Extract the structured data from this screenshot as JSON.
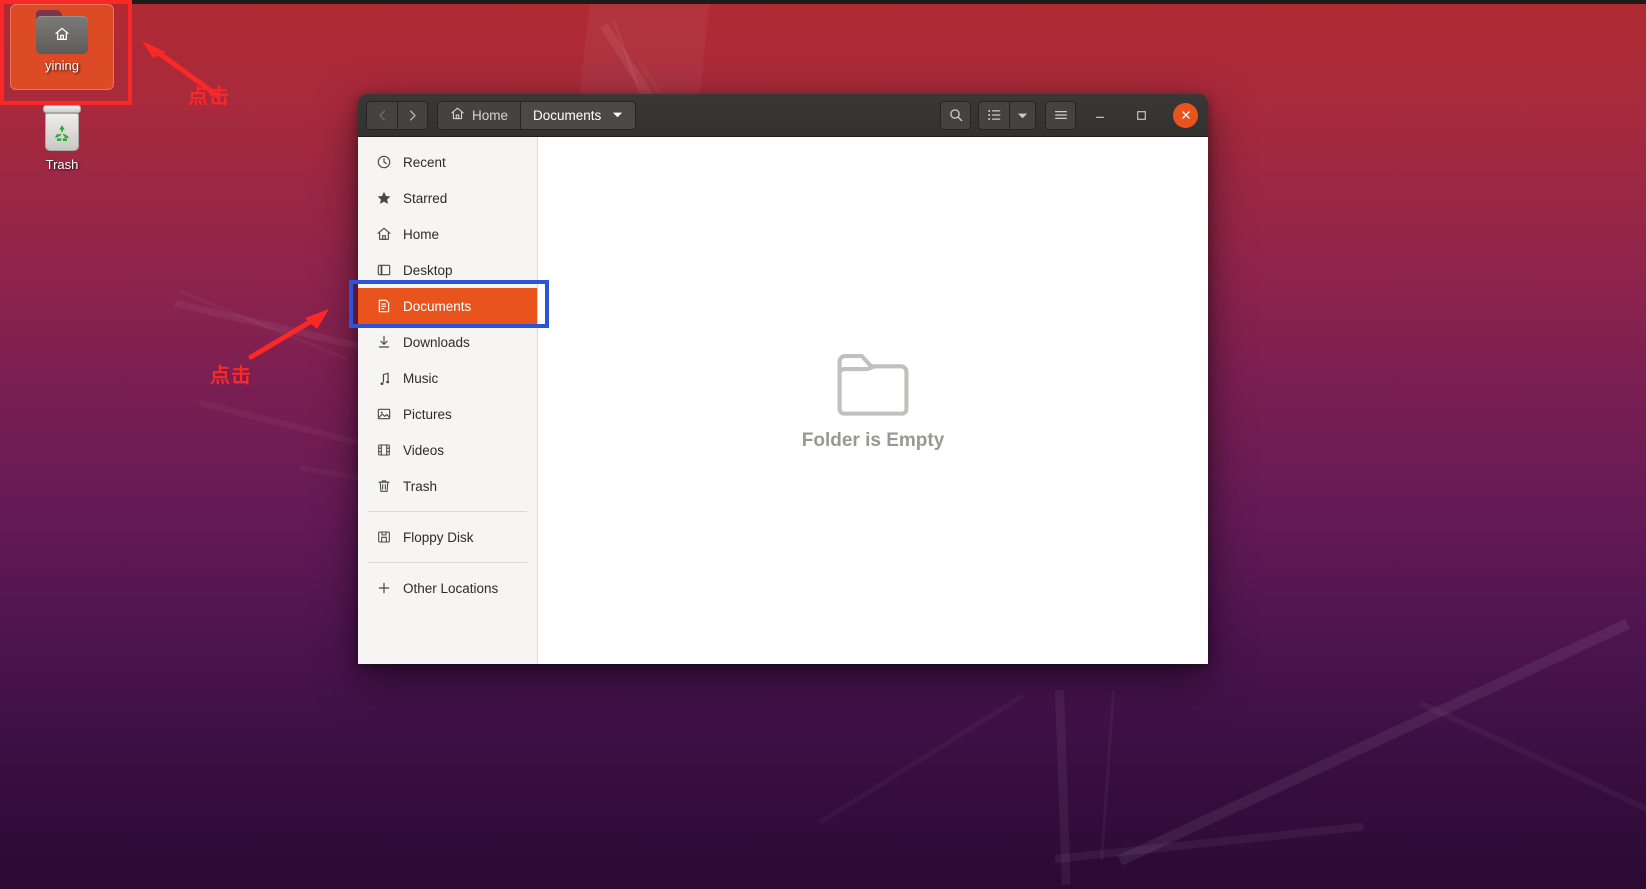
{
  "desktop": {
    "icons": [
      {
        "name": "yining",
        "label": "yining",
        "icon": "home-folder-icon",
        "selected": true
      },
      {
        "name": "trash",
        "label": "Trash",
        "icon": "trash-icon",
        "selected": false
      }
    ],
    "wallpaper_colors": {
      "top": "#b02a32",
      "mid": "#7c1f52",
      "bottom": "#2b0a33"
    }
  },
  "annotations": {
    "highlight_yining_color": "#fb2828",
    "highlight_documents_color": "#2b55d6",
    "arrow_color": "#fb2828",
    "callout_1": "点击",
    "callout_2": "点击"
  },
  "window": {
    "title": "Documents",
    "header": {
      "back_label": "Back",
      "forward_label": "Forward",
      "breadcrumbs": [
        {
          "label": "Home",
          "icon": "home-icon",
          "active": false
        },
        {
          "label": "Documents",
          "icon": "chevron-down-icon",
          "active": true
        }
      ],
      "toolbar_buttons": [
        {
          "name": "search-button",
          "icon": "search-icon"
        },
        {
          "name": "view-list-button",
          "icon": "list-view-icon"
        },
        {
          "name": "view-options-button",
          "icon": "chevron-down-icon"
        },
        {
          "name": "main-menu-button",
          "icon": "hamburger-menu-icon"
        }
      ],
      "window_controls": [
        {
          "name": "minimize-button",
          "icon": "minimize-icon"
        },
        {
          "name": "maximize-button",
          "icon": "maximize-icon"
        },
        {
          "name": "close-button",
          "icon": "close-icon",
          "color": "#e9541d"
        }
      ]
    },
    "sidebar": {
      "items": [
        {
          "label": "Recent",
          "icon": "clock-icon",
          "selected": false
        },
        {
          "label": "Starred",
          "icon": "star-icon",
          "selected": false
        },
        {
          "label": "Home",
          "icon": "home-icon",
          "selected": false
        },
        {
          "label": "Desktop",
          "icon": "desktop-icon",
          "selected": false
        },
        {
          "label": "Documents",
          "icon": "document-icon",
          "selected": true
        },
        {
          "label": "Downloads",
          "icon": "download-icon",
          "selected": false
        },
        {
          "label": "Music",
          "icon": "music-icon",
          "selected": false
        },
        {
          "label": "Pictures",
          "icon": "picture-icon",
          "selected": false
        },
        {
          "label": "Videos",
          "icon": "video-icon",
          "selected": false
        },
        {
          "label": "Trash",
          "icon": "trash-icon",
          "selected": false
        },
        {
          "label": "Floppy Disk",
          "icon": "floppy-icon",
          "selected": false
        },
        {
          "label": "Other Locations",
          "icon": "plus-icon",
          "selected": false
        }
      ],
      "selected_color": "#e9541d"
    },
    "content": {
      "empty_message": "Folder is Empty",
      "empty_icon": "folder-outline-icon"
    }
  }
}
